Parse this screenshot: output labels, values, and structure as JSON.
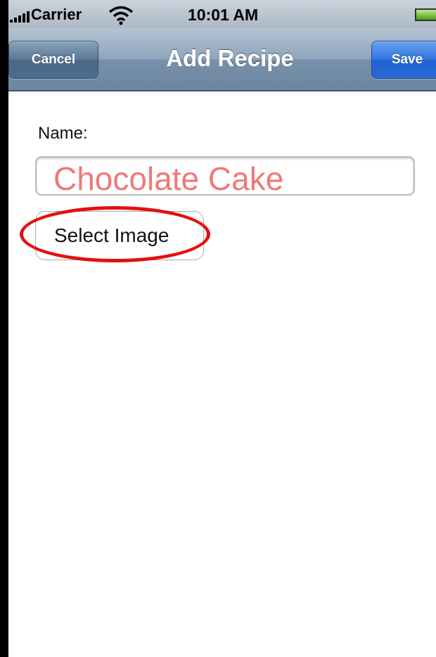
{
  "status_bar": {
    "carrier": "Carrier",
    "time": "10:01 AM",
    "signal_icon": "signal-bars-icon",
    "wifi_icon": "wifi-icon",
    "battery_icon": "battery-icon"
  },
  "nav_bar": {
    "title": "Add Recipe",
    "cancel_label": "Cancel",
    "save_label": "Save"
  },
  "form": {
    "name_label": "Name:",
    "name_value": "Chocolate Cake",
    "select_image_label": "Select Image"
  },
  "annotation": {
    "highlight_color": "#e31010"
  },
  "colors": {
    "save_accent": "#2f73dd",
    "name_text": "#f07878"
  }
}
